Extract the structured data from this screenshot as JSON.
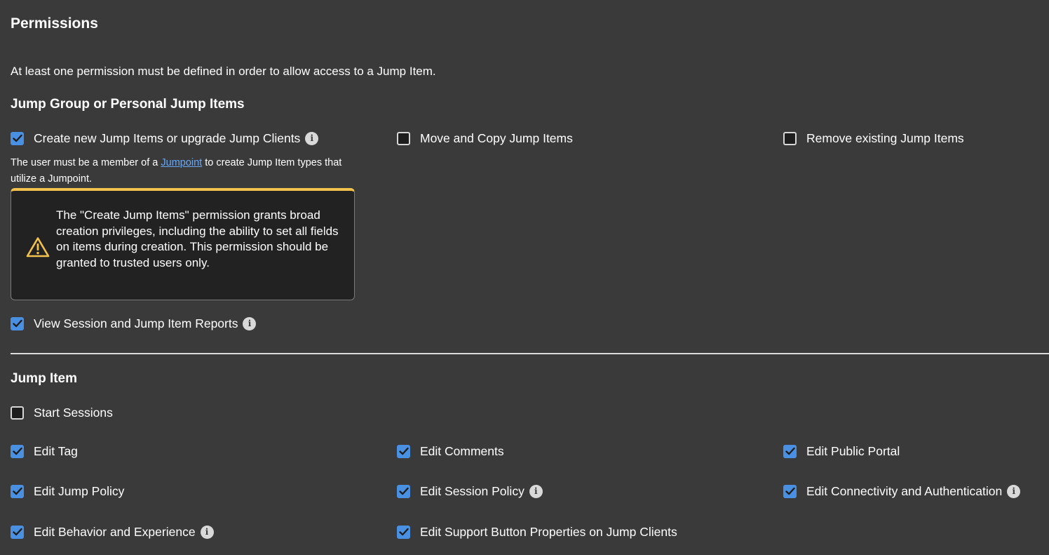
{
  "page_title": "Permissions",
  "intro_text": "At least one permission must be defined in order to allow access to a Jump Item.",
  "jump_group_section": {
    "title": "Jump Group or Personal Jump Items",
    "create_items": {
      "label": "Create new Jump Items or upgrade Jump Clients",
      "checked": true
    },
    "move_copy": {
      "label": "Move and Copy Jump Items",
      "checked": false
    },
    "remove_items": {
      "label": "Remove existing Jump Items",
      "checked": false
    },
    "note_before": "The user must be a member of a ",
    "note_link": "Jumpoint",
    "note_after": " to create Jump Item types that utilize a Jumpoint.",
    "warning_text": "The \"Create Jump Items\" permission grants broad creation privileges, including the ability to set all fields on items during creation. This permission should be granted to trusted users only.",
    "view_reports": {
      "label": "View Session and Jump Item Reports",
      "checked": true
    }
  },
  "jump_item_section": {
    "title": "Jump Item",
    "start_sessions": {
      "label": "Start Sessions",
      "checked": false
    },
    "edit_tag": {
      "label": "Edit Tag",
      "checked": true
    },
    "edit_comments": {
      "label": "Edit Comments",
      "checked": true
    },
    "edit_public_portal": {
      "label": "Edit Public Portal",
      "checked": true
    },
    "edit_jump_policy": {
      "label": "Edit Jump Policy",
      "checked": true
    },
    "edit_session_policy": {
      "label": "Edit Session Policy",
      "checked": true
    },
    "edit_connectivity": {
      "label": "Edit Connectivity and Authentication",
      "checked": true
    },
    "edit_behavior": {
      "label": "Edit Behavior and Experience",
      "checked": true
    },
    "edit_support_button": {
      "label": "Edit Support Button Properties on Jump Clients",
      "checked": true
    }
  },
  "colors": {
    "background": "#3a3a3a",
    "checkbox_checked": "#4a90e2",
    "warning_accent": "#f2c14e",
    "link": "#6aa7f5"
  }
}
